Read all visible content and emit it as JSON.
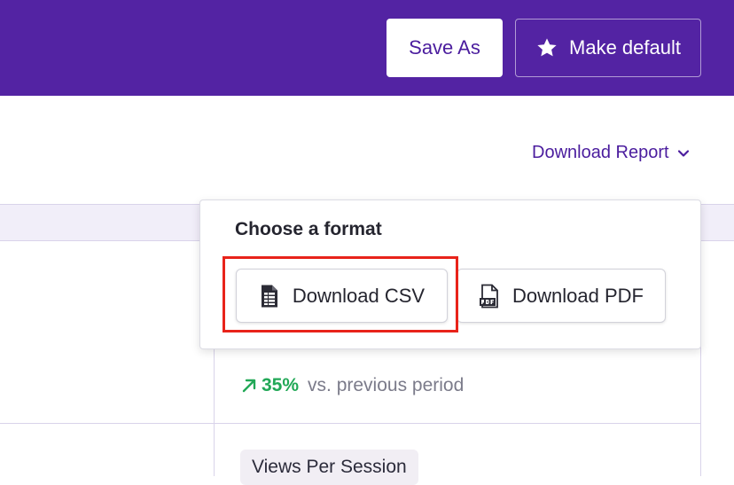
{
  "header": {
    "save_as_label": "Save As",
    "make_default_label": "Make default"
  },
  "report": {
    "download_label": "Download Report"
  },
  "dropdown": {
    "title": "Choose a format",
    "csv_label": "Download CSV",
    "pdf_label": "Download PDF"
  },
  "metric": {
    "change_value": "35%",
    "change_suffix": "vs. previous period",
    "next_metric_label": "Views Per Session"
  },
  "colors": {
    "brand": "#5323a3",
    "accent_text": "#4b1d9e",
    "positive": "#22a857",
    "highlight": "#e8231a"
  },
  "icons": {
    "make_default": "star-icon",
    "download_report": "chevron-down-icon",
    "csv": "spreadsheet-icon",
    "pdf": "pdf-file-icon",
    "change": "arrow-up-right-icon"
  }
}
